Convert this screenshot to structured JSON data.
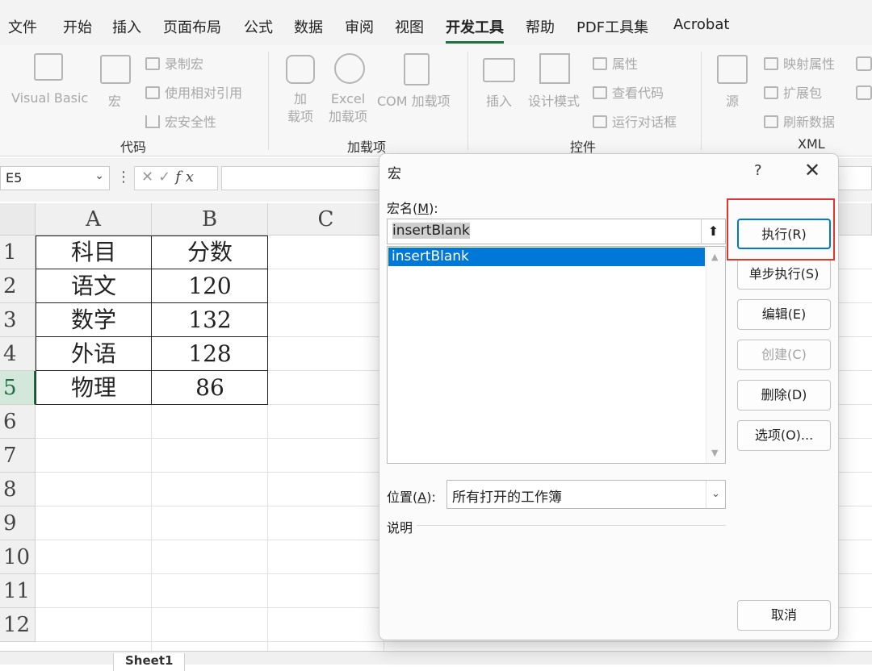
{
  "menu": {
    "tabs": [
      "文件",
      "开始",
      "插入",
      "页面布局",
      "公式",
      "数据",
      "审阅",
      "视图",
      "开发工具",
      "帮助",
      "PDF工具集",
      "Acrobat"
    ],
    "active": "开发工具"
  },
  "ribbon": {
    "code": {
      "label": "代码",
      "visual_basic": "Visual Basic",
      "macros": "宏",
      "record_macro": "录制宏",
      "relative_ref": "使用相对引用",
      "macro_security": "宏安全性"
    },
    "addins": {
      "label": "加载项",
      "addins_line1": "加",
      "addins_line2": "载项",
      "excel_line1": "Excel",
      "excel_line2": "加载项",
      "com": "COM 加载项"
    },
    "controls": {
      "label": "控件",
      "insert": "插入",
      "design_mode": "设计模式",
      "properties": "属性",
      "view_code": "查看代码",
      "run_dialog": "运行对话框"
    },
    "xml": {
      "label": "XML",
      "source": "源",
      "map_props": "映射属性",
      "expansion": "扩展包",
      "refresh": "刷新数据"
    }
  },
  "formula_bar": {
    "name_box": "E5",
    "fx": "fx",
    "value": ""
  },
  "sheet": {
    "columns": [
      "A",
      "B",
      "C"
    ],
    "rows": [
      "1",
      "2",
      "3",
      "4",
      "5",
      "6",
      "7",
      "8",
      "9",
      "10",
      "11",
      "12"
    ],
    "selected_row": "5",
    "cells": [
      [
        "科目",
        "分数"
      ],
      [
        "语文",
        "120"
      ],
      [
        "数学",
        "132"
      ],
      [
        "外语",
        "128"
      ],
      [
        "物理",
        "86"
      ]
    ],
    "tabs": [
      "Sheet1"
    ]
  },
  "dialog": {
    "title": "宏",
    "help": "?",
    "close": "✕",
    "name_label": "宏名(",
    "name_key": "M",
    "name_label_end": "):",
    "name_value": "insertBlank",
    "macros": [
      "insertBlank"
    ],
    "location_label": "位置(",
    "location_key": "A",
    "location_label_end": "):",
    "location_value": "所有打开的工作簿",
    "description_label": "说明",
    "buttons": {
      "run": "执行(R)",
      "step_into": "单步执行(S)",
      "edit": "编辑(E)",
      "create": "创建(C)",
      "delete": "删除(D)",
      "options": "选项(O)...",
      "cancel": "取消"
    }
  },
  "colors": {
    "accent_green": "#1e7145",
    "selection_blue": "#0078d7",
    "callout_red": "#e2362b"
  }
}
